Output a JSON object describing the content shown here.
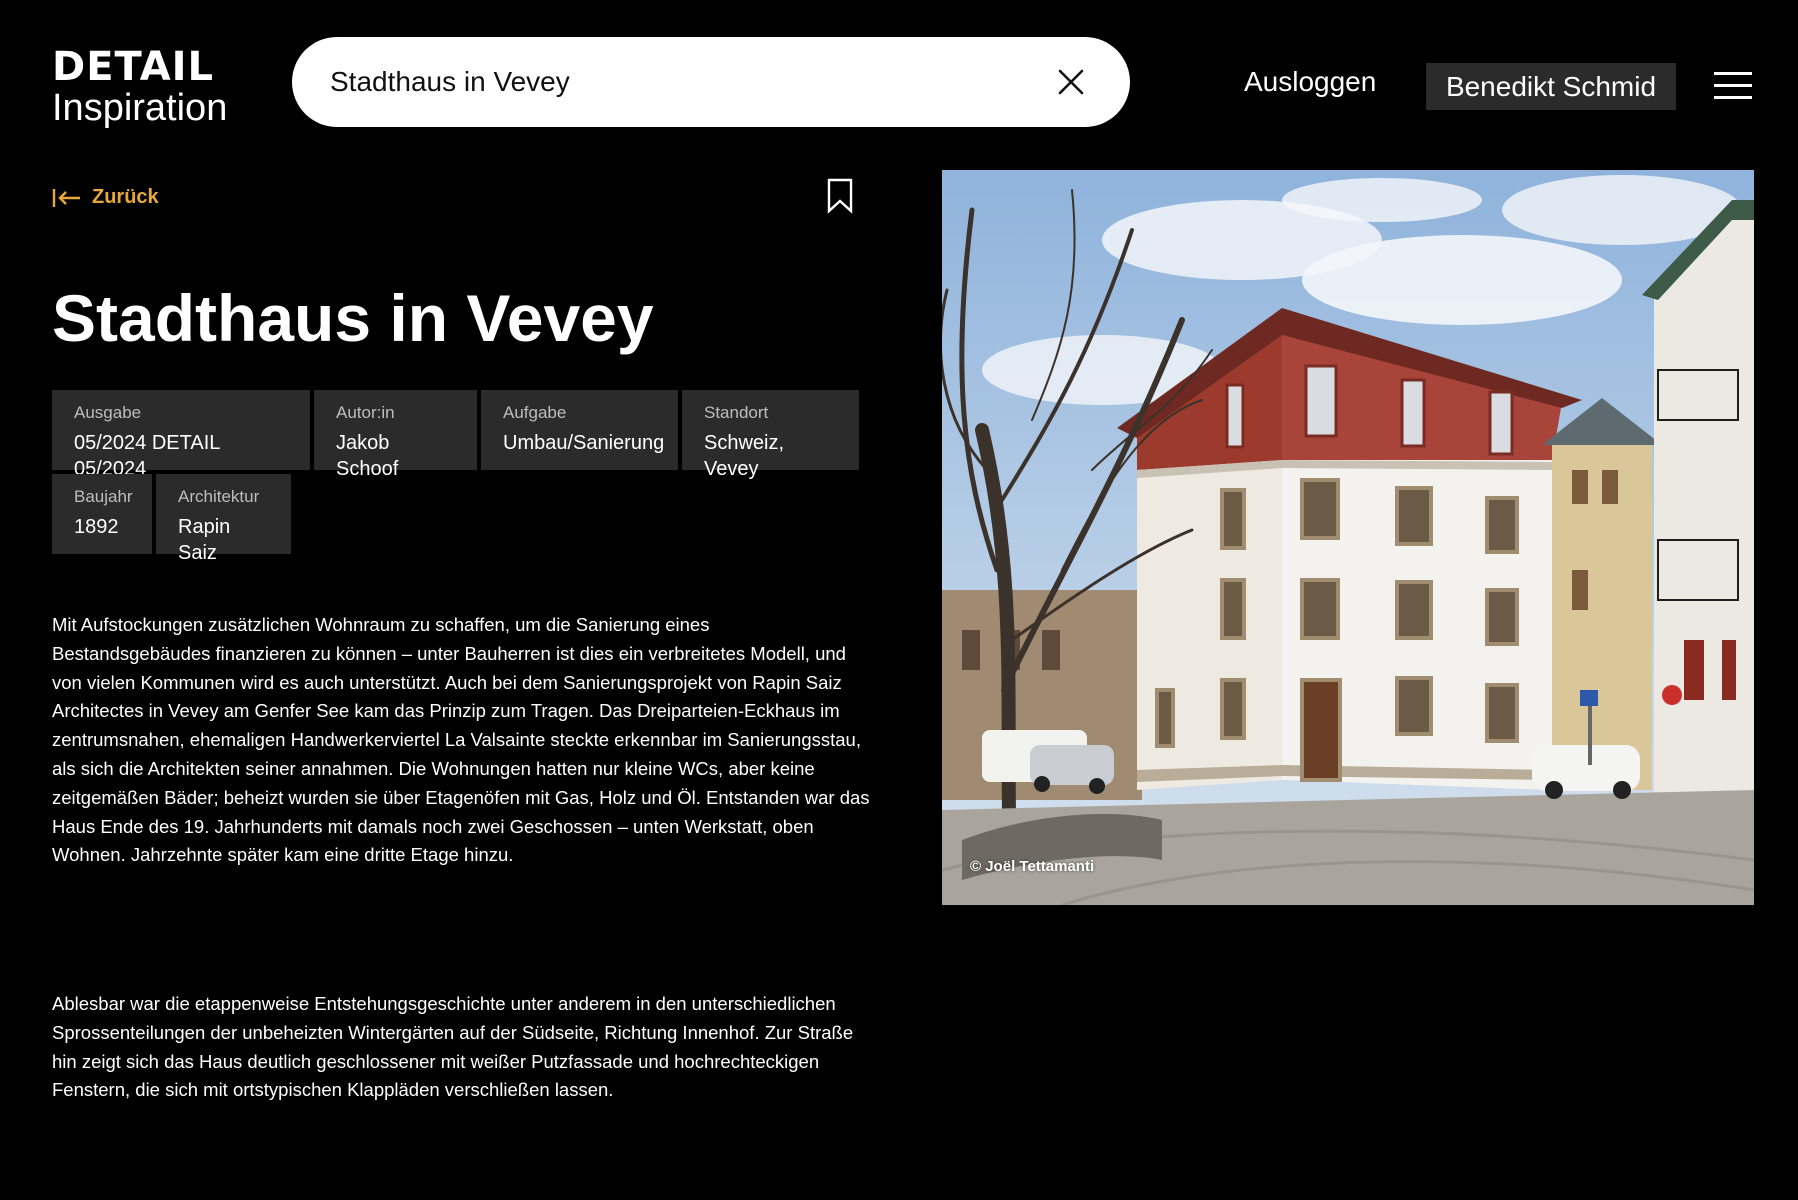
{
  "header": {
    "logo_top": "DETAIL",
    "logo_bottom": "Inspiration",
    "search_value": "Stadthaus in Vevey",
    "logout_label": "Ausloggen",
    "user_name": "Benedikt Schmid"
  },
  "nav": {
    "back_label": "Zurück",
    "back_icon": "arrow-left-bar-icon",
    "bookmark_icon": "bookmark-icon",
    "menu_icon": "hamburger-menu-icon",
    "clear_icon": "close-icon"
  },
  "article": {
    "title": "Stadthaus in Vevey",
    "meta": [
      {
        "label": "Ausgabe",
        "value": "05/2024 DETAIL 05/2024"
      },
      {
        "label": "Autor:in",
        "value": "Jakob Schoof"
      },
      {
        "label": "Aufgabe",
        "value": "Umbau/Sanierung"
      },
      {
        "label": "Standort",
        "value": "Schweiz, Vevey"
      },
      {
        "label": "Baujahr",
        "value": "1892"
      },
      {
        "label": "Architektur",
        "value": "Rapin Saiz"
      }
    ],
    "paragraph_1": "Mit Aufstockungen zusätzlichen Wohnraum zu schaffen, um die Sanierung eines Bestandsgebäudes finanzieren zu können – unter Bauherren ist dies ein verbreitetes Modell, und von vielen Kommunen wird es auch unterstützt. Auch bei dem Sanierungsprojekt von Rapin Saiz Architectes in Vevey am Genfer See kam das Prinzip zum Tragen. Das Dreiparteien-Eckhaus im zentrumsnahen, ehemaligen Handwerkerviertel La Valsainte steck­te erkennbar im Sanierungsstau, als sich die Architekten seiner annahmen. Die Wohnungen hatten nur kleine WCs, aber keine zeitgemäßen Bäder; beheizt wurden sie über Etagenöfen mit Gas, Holz und Öl. Entstanden war das Haus Ende des 19. Jahrhunderts mit damals noch zwei Geschossen – unten Werkstatt, oben Wohnen. Jahrzehnte später kam eine dritte Etage hinzu.",
    "paragraph_2": "Ablesbar war die etappenweise Entstehungsgeschichte unter anderem in den unterschiedlichen Sprossenteilungen der unbeheizten Wintergärten auf der Südseite, Richtung Innenhof. Zur Straße hin zeigt sich das Haus deutlich geschlossener mit weißer Putzfassade und hochrechteckigen Fenstern, die sich mit ortstypischen Klappläden verschließen lassen.",
    "photo_credit": "© Joël Tettamanti"
  },
  "colors": {
    "background": "#000000",
    "accent": "#e8a93c",
    "meta_bg": "#2b2b2b",
    "user_bg": "#2b2b2b"
  }
}
